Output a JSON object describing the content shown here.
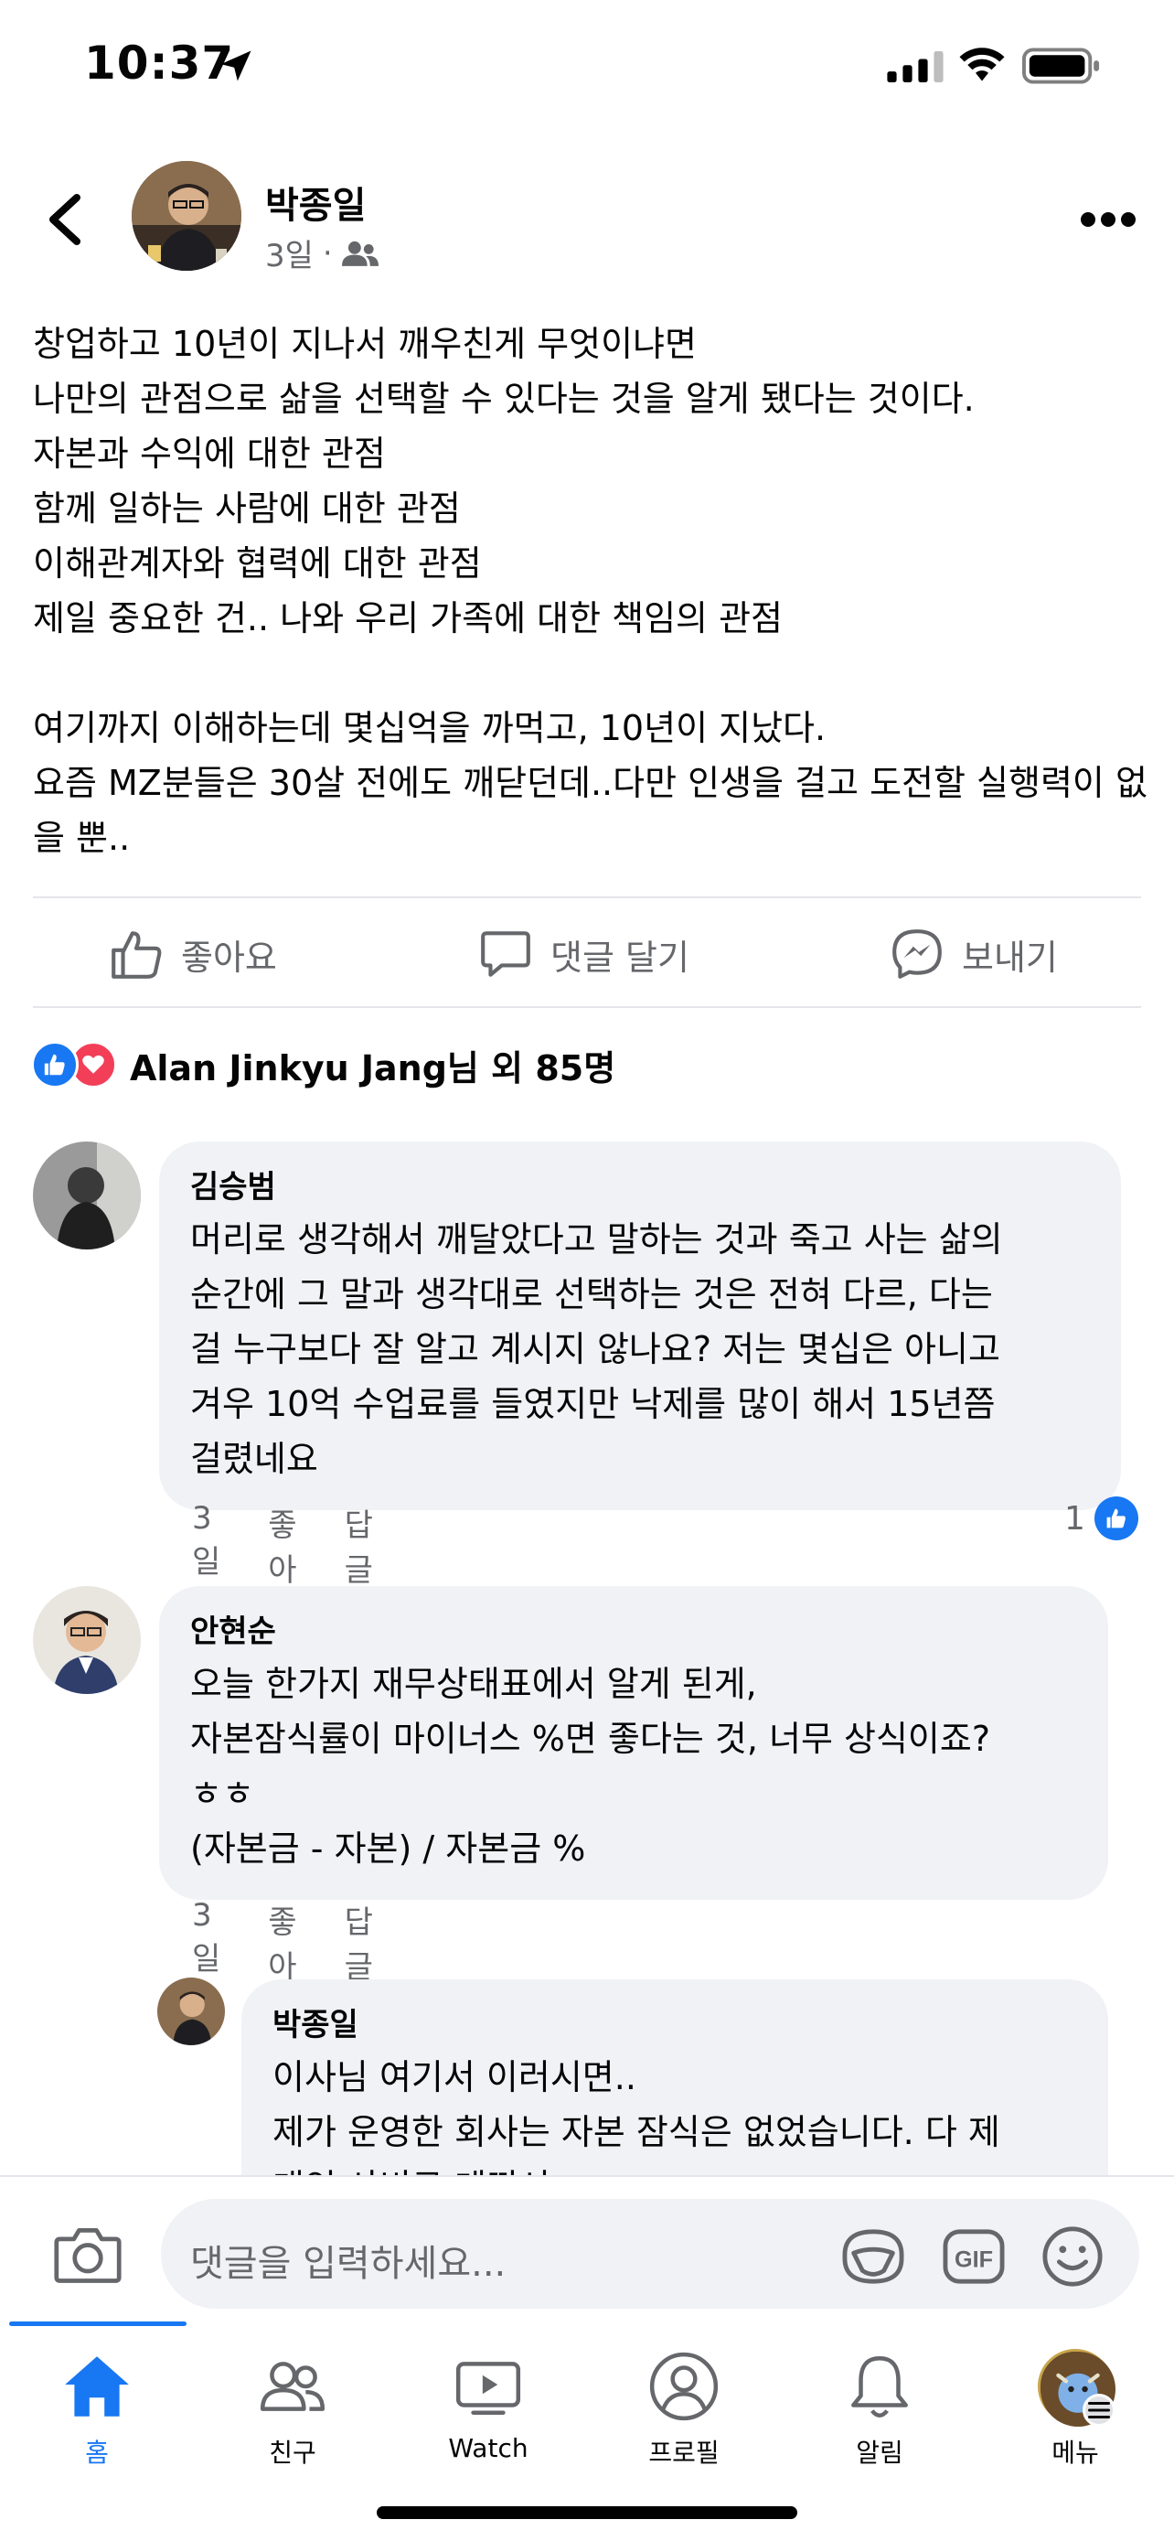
{
  "status": {
    "time": "10:37"
  },
  "post": {
    "author": "박종일",
    "time": "3일",
    "audience_icon": "friends-icon",
    "body": "창업하고 10년이 지나서 깨우친게 무엇이냐면\n나만의 관점으로 삶을 선택할 수 있다는 것을 알게 됐다는 것이다.\n자본과 수익에 대한 관점\n함께 일하는 사람에 대한 관점\n이해관계자와 협력에 대한 관점\n제일 중요한 건.. 나와 우리 가족에 대한 책임의 관점\n\n여기까지 이해하는데 몇십억을 까먹고, 10년이 지났다.\n요즘 MZ분들은 30살 전에도 깨닫던데..다만 인생을 걸고 도전할 실행력이 없을 뿐.."
  },
  "actions": {
    "like": "좋아요",
    "comment": "댓글 달기",
    "send": "보내기"
  },
  "reactions": {
    "summary": "Alan Jinkyu Jang님 외 85명"
  },
  "comments": [
    {
      "name": "김승범",
      "text": "머리로 생각해서 깨달았다고 말하는 것과 죽고 사는 삶의\n순간에 그 말과 생각대로 선택하는 것은 전혀 다르, 다는\n걸 누구보다 잘 알고 계시지 않나요? 저는 몇십은 아니고\n겨우 10억 수업료를 들였지만 낙제를 많이 해서 15년쯤\n걸렸네요",
      "time": "3일",
      "like": "좋아요",
      "reply": "답글 달기",
      "reaction_count": "1"
    },
    {
      "name": "안현순",
      "text": "오늘 한가지 재무상태표에서 알게 된게,\n자본잠식률이 마이너스 %면 좋다는 것, 너무 상식이죠?\nㅎㅎ\n(자본금 - 자본) / 자본금 %",
      "time": "3일",
      "like": "좋아요",
      "reply": "답글 달기"
    },
    {
      "name": "박종일",
      "text": "이사님 여기서 이러시면..\n제가 운영한 회사는 자본 잠식은 없었습니다. 다 제\n개인 사비로 메꿔서 ㅋㅋㅋ"
    }
  ],
  "comment_input": {
    "placeholder": "댓글을 입력하세요..."
  },
  "nav": [
    {
      "label": "홈",
      "icon": "home-icon"
    },
    {
      "label": "친구",
      "icon": "friends-icon"
    },
    {
      "label": "Watch",
      "icon": "watch-icon"
    },
    {
      "label": "프로필",
      "icon": "profile-icon"
    },
    {
      "label": "알림",
      "icon": "bell-icon"
    },
    {
      "label": "메뉴",
      "icon": "menu-icon"
    }
  ],
  "colors": {
    "accent": "#1877f2",
    "love": "#f33e58",
    "bubble": "#f0f2f5",
    "muted": "#65676b"
  }
}
